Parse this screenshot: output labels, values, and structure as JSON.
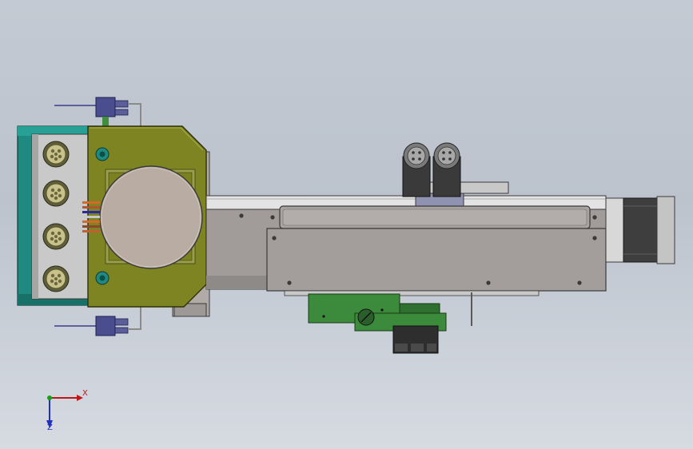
{
  "view": {
    "background_top": "#c3cad3",
    "background_bottom": "#d6dbe2"
  },
  "triad": {
    "x_label": "X",
    "z_label": "Z",
    "x_color": "#c01818",
    "y_color": "#18a018",
    "z_color": "#2030c0"
  },
  "colors": {
    "teal_housing": "#1e8a80",
    "olive_plate": "#7f8422",
    "grey_body": "#a19c9a",
    "light_grey": "#d2d2d2",
    "disc": "#b9aca3",
    "pcb_green": "#3c8a3c",
    "connector_blue": "#4b4e8e",
    "motor_dark": "#3e3e3e"
  },
  "icons": {
    "connector": "circular-connector-icon",
    "screw": "screw-head-icon",
    "triad": "axis-triad-icon"
  }
}
